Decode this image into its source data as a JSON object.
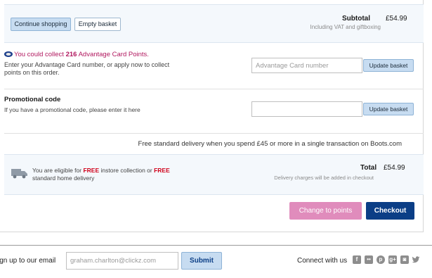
{
  "basket": {
    "continue_label": "Continue shopping",
    "empty_label": "Empty basket",
    "subtotal_label": "Subtotal",
    "subtotal_value": "£54.99",
    "vat_note": "Including VAT and giftboxing"
  },
  "advantage": {
    "title_prefix": "You could collect ",
    "points": "216",
    "title_suffix": " Advantage Card Points.",
    "description": "Enter your Advantage Card number, or apply now to collect points on this order.",
    "input_placeholder": "Advantage Card number",
    "update_label": "Update basket"
  },
  "promo": {
    "title": "Promotional code",
    "description": "If you have a promotional code, please enter it here",
    "input_value": "",
    "update_label": "Update basket"
  },
  "delivery": {
    "free_delivery_text": "Free standard delivery when you spend £45 or more in a single transaction on Boots.com",
    "eligible_prefix": "You are eligible for ",
    "free_word_1": "FREE",
    "eligible_middle": " instore collection or ",
    "free_word_2": "FREE",
    "eligible_suffix": " standard home delivery",
    "total_label": "Total",
    "total_value": "£54.99",
    "charges_note": "Delivery charges will be added in checkout"
  },
  "actions": {
    "points_label": "Change to points",
    "checkout_label": "Checkout"
  },
  "footer": {
    "signup_label": "ign up to our email",
    "email_placeholder": "graham.charlton@clickz.com",
    "submit_label": "Submit",
    "connect_label": "Connect with us",
    "social_icons": [
      "facebook-icon",
      "flickr-icon",
      "pinterest-icon",
      "google-plus-icon",
      "instagram-icon",
      "twitter-icon"
    ]
  },
  "colors": {
    "accent_blue": "#0b3e86",
    "light_blue_button": "#c7dcf1",
    "pink_button": "#e08cbc",
    "advantage_magenta": "#b1185f",
    "free_red": "#d0021b"
  }
}
